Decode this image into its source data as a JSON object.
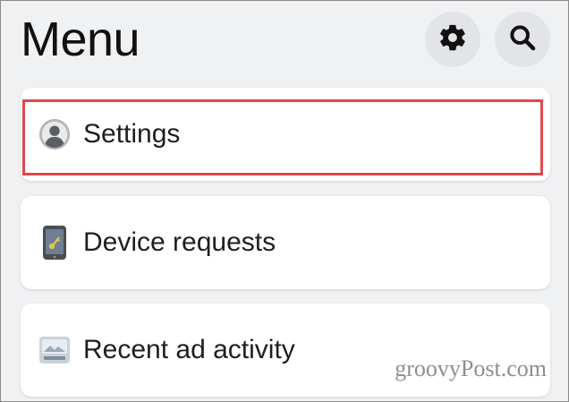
{
  "header": {
    "title": "Menu",
    "settings_icon": "gear-icon",
    "search_icon": "search-icon"
  },
  "menu_items": [
    {
      "label": "Settings",
      "icon": "profile-avatar-icon",
      "highlighted": true
    },
    {
      "label": "Device requests",
      "icon": "phone-key-icon"
    },
    {
      "label": "Recent ad activity",
      "icon": "ad-activity-icon"
    }
  ],
  "watermark": "groovyPost.com",
  "colors": {
    "background": "#f0f1f3",
    "card": "#ffffff",
    "highlight": "#e0474c",
    "icon_button_bg": "#e2e4e8"
  }
}
